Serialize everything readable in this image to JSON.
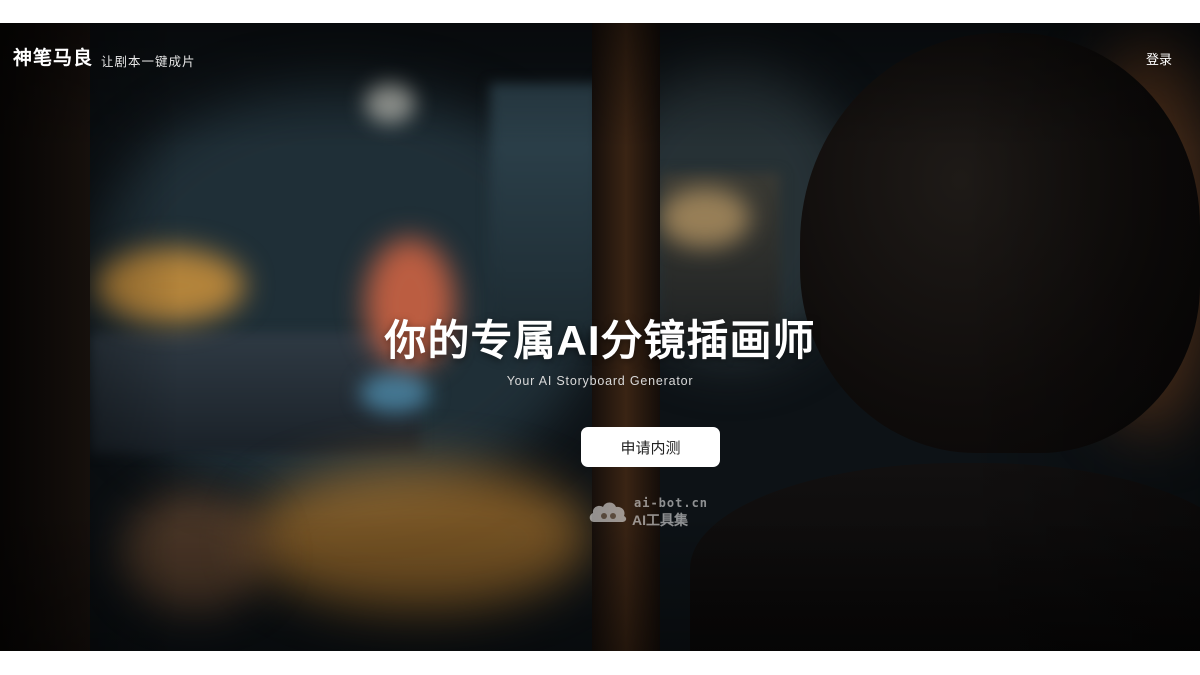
{
  "header": {
    "logo_text": "神笔马良",
    "tagline": "让剧本一键成片",
    "login_label": "登录"
  },
  "hero": {
    "title": "你的专属AI分镜插画师",
    "subtitle": "Your AI Storyboard Generator",
    "cta_label": "申请内测"
  },
  "watermark": {
    "domain": "ai-bot.cn",
    "name": "AI工具集",
    "icon": "cloud-logo-icon"
  },
  "colors": {
    "page_background": "#ffffff",
    "hero_background": "#0d1216",
    "cta_background": "#ffffff",
    "cta_text": "#222222",
    "text_primary": "#ffffff"
  }
}
